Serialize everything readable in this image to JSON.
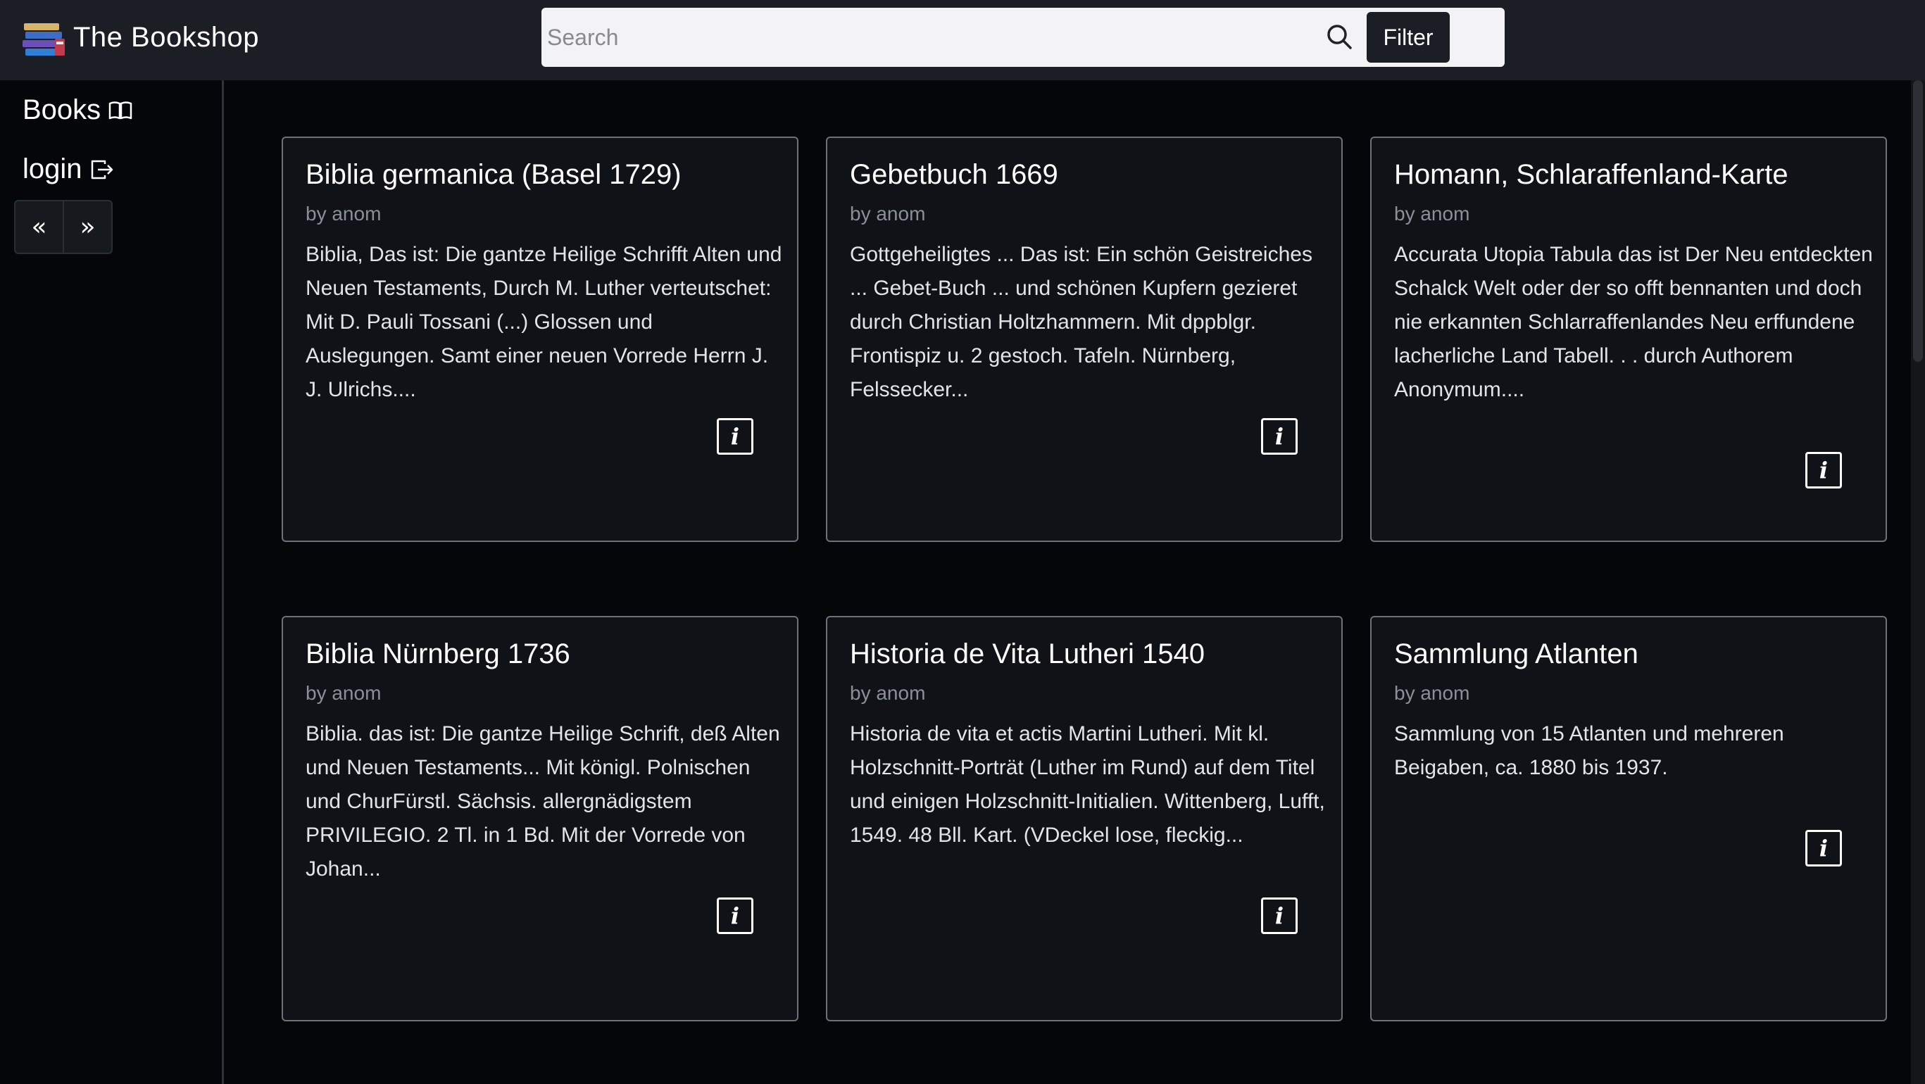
{
  "brand": {
    "title": "The Bookshop"
  },
  "search": {
    "placeholder": "Search",
    "value": "",
    "filter_label": "Filter"
  },
  "sidebar": {
    "books_label": "Books",
    "login_label": "login",
    "prev_label": "«",
    "next_label": "»"
  },
  "books": [
    {
      "title": "Biblia germanica (Basel 1729)",
      "author": "by anom",
      "description": "Biblia, Das ist: Die gantze Heilige Schrifft Alten und Neuen Testaments, Durch M. Luther verteutschet: Mit D. Pauli Tossani (...) Glossen und Auslegungen. Samt einer neuen Vorrede Herrn J. J. Ulrichs....",
      "info_icon": "info-icon"
    },
    {
      "title": "Gebetbuch 1669",
      "author": "by anom",
      "description": "Gottgeheiligtes ... Das ist: Ein schön Geistreiches ... Gebet-Buch ... und schönen Kupfern gezieret durch Christian Holtzhammern. Mit dppblgr. Frontispiz u. 2 gestoch. Tafeln. Nürnberg, Felssecker...",
      "info_icon": "info-icon"
    },
    {
      "title": "Homann, Schlaraffenland-Karte",
      "author": "by anom",
      "description": "Accurata Utopia Tabula das ist Der Neu entdeckten Schalck Welt oder der so offt bennanten und doch nie erkannten Schlarraffenlandes Neu erffundene lacherliche Land Tabell. . . durch Authorem Anonymum....",
      "info_icon": "info-icon"
    },
    {
      "title": "Biblia Nürnberg 1736",
      "author": "by anom",
      "description": "Biblia. das ist: Die gantze Heilige Schrift, deß Alten und Neuen Testaments... Mit königl. Polnischen und ChurFürstl. Sächsis. allergnädigstem PRIVILEGIO. 2 Tl. in 1 Bd. Mit der Vorrede von Johan...",
      "info_icon": "info-icon"
    },
    {
      "title": "Historia de Vita Lutheri 1540",
      "author": "by anom",
      "description": "Historia de vita et actis Martini Lutheri. Mit kl. Holzschnitt-Porträt (Luther im Rund) auf dem Titel und einigen Holzschnitt-Initialien. Wittenberg, Lufft, 1549. 48 Bll. Kart. (VDeckel lose, fleckig...",
      "info_icon": "info-icon"
    },
    {
      "title": "Sammlung Atlanten",
      "author": "by anom",
      "description": "Sammlung von 15 Atlanten und mehreren Beigaben, ca. 1880 bis 1937.",
      "info_icon": "info-icon"
    }
  ],
  "colors": {
    "background": "#04060a",
    "navbar": "#1b1e24",
    "card_border": "#6e7178",
    "muted_text": "#8b8f96"
  }
}
